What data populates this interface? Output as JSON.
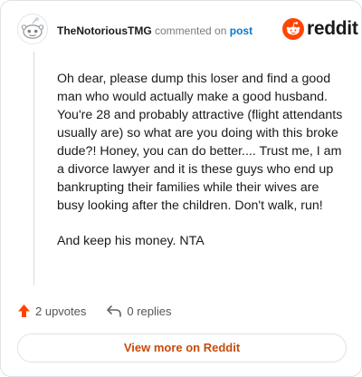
{
  "header": {
    "username": "TheNotoriousTMG",
    "action_text": "commented on",
    "post_link": "post"
  },
  "brand": {
    "name": "reddit",
    "icon": "reddit-logo-icon",
    "color": "#ff4500"
  },
  "comment": {
    "paragraphs": [
      "Oh dear, please dump this loser and find a good man who would actually make a good husband. You're 28 and probably attractive (flight attendants usually are) so what are you doing with this broke dude?! Honey, you can do better.... Trust me, I am a divorce lawyer and it is these guys who end up bankrupting their families while their wives are busy looking after the children. Don't walk, run!",
      "And keep his money. NTA"
    ]
  },
  "actions": {
    "upvotes": "2 upvotes",
    "upvote_icon": "upvote-arrow-icon",
    "upvote_color": "#ff4500",
    "replies": "0 replies",
    "reply_icon": "reply-arrow-icon"
  },
  "footer": {
    "view_more": "View more on Reddit"
  }
}
